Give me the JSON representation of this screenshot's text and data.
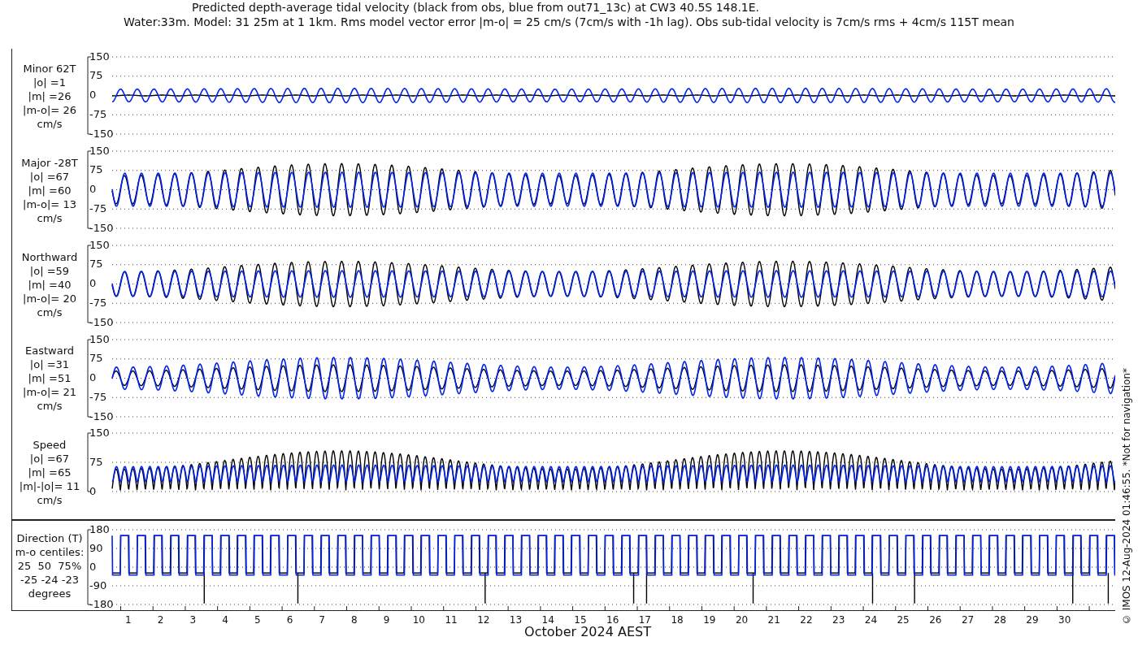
{
  "title_lines": [
    "Predicted depth-average tidal velocity (black from obs, blue from out71_13c) at CW3 40.5S 148.1E.",
    "Water:33m. Model: 31 25m at 1 1km. Rms model vector error |m-o| = 25 cm/s (7cm/s with -1h lag). Obs sub-tidal velocity is 7cm/s rms + 4cm/s 115T mean"
  ],
  "panels": [
    {
      "kind": "minor",
      "label_lines": [
        "Minor 62T",
        "|o| =1",
        "|m| =26",
        "|m-o|= 26",
        "cm/s"
      ],
      "yticks": [
        "150",
        "75",
        "0",
        "-75",
        "-150"
      ]
    },
    {
      "kind": "major",
      "label_lines": [
        "Major -28T",
        "|o| =67",
        "|m| =60",
        "|m-o|= 13",
        "cm/s"
      ],
      "yticks": [
        "150",
        "75",
        "0",
        "-75",
        "-150"
      ]
    },
    {
      "kind": "northward",
      "label_lines": [
        "Northward",
        "|o| =59",
        "|m| =40",
        "|m-o|= 20",
        "cm/s"
      ],
      "yticks": [
        "150",
        "75",
        "0",
        "-75",
        "-150"
      ]
    },
    {
      "kind": "eastward",
      "label_lines": [
        "Eastward",
        "|o| =31",
        "|m| =51",
        "|m-o|= 21",
        "cm/s"
      ],
      "yticks": [
        "150",
        "75",
        "0",
        "-75",
        "-150"
      ]
    },
    {
      "kind": "speed",
      "label_lines": [
        "Speed",
        "|o| =67",
        "|m| =65",
        "|m|-|o|= 11",
        "cm/s"
      ],
      "yticks": [
        "150",
        "75",
        "0"
      ]
    },
    {
      "kind": "direction",
      "label_lines": [
        "Direction (T)",
        "m-o centiles:",
        "25  50  75%",
        "-25 -24 -23",
        "degrees"
      ],
      "yticks": [
        "180",
        "90",
        "0",
        "-90",
        "-180"
      ]
    }
  ],
  "xticks": [
    "1",
    "2",
    "3",
    "4",
    "5",
    "6",
    "7",
    "8",
    "9",
    "10",
    "11",
    "12",
    "13",
    "14",
    "15",
    "16",
    "17",
    "18",
    "19",
    "20",
    "21",
    "22",
    "23",
    "24",
    "25",
    "26",
    "27",
    "28",
    "29",
    "30"
  ],
  "xlabel": "October 2024 AEST",
  "side_note": "© IMOS 12-Aug-2024 01:46:55. *Not for navigation*"
}
